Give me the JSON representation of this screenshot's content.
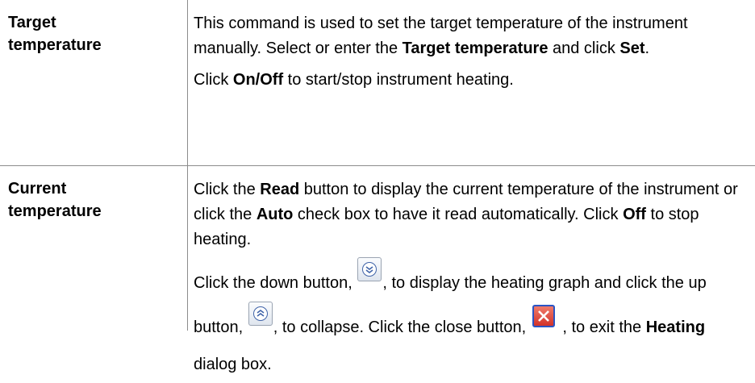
{
  "rows": [
    {
      "term_line1": "Target",
      "term_line2": "temperature",
      "p1_a": "This command is used to set the target temperature of the instrument manually. Select or enter the ",
      "p1_b": "Target temperature",
      "p1_c": " and click ",
      "p1_d": "Set",
      "p1_e": ".",
      "p2_a": "Click ",
      "p2_b": "On/Off",
      "p2_c": " to start/stop instrument heating."
    },
    {
      "term_line1": "Current",
      "term_line2": "temperature",
      "p1_a": "Click the ",
      "p1_b": "Read",
      "p1_c": " button to display the current temperature of the instrument or click the ",
      "p1_d": "Auto",
      "p1_e": " check box to have it read automatically. Click ",
      "p1_f": "Off",
      "p1_g": " to stop heating.",
      "p2_a": "Click the down button, ",
      "p2_b": ", to display the heating graph and click the up button, ",
      "p2_c": ", to collapse. Click the close button, ",
      "p2_d": " , to exit the ",
      "p2_e": "Heating",
      "p2_f": " dialog box."
    }
  ],
  "icons": {
    "down": "expand-down-icon",
    "up": "collapse-up-icon",
    "close": "close-icon",
    "accent": "#3f63a8",
    "close_bg": "#d2322a"
  }
}
